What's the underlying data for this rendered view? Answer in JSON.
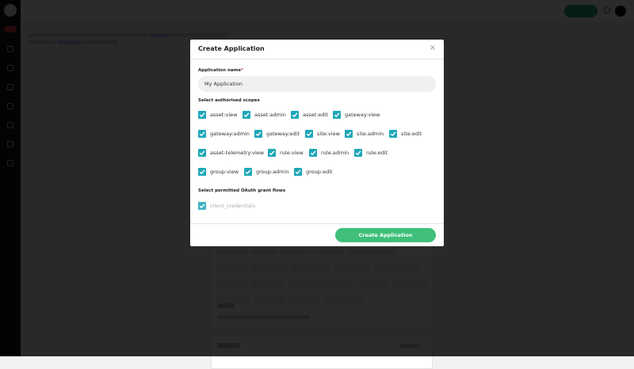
{
  "modal": {
    "title": "Create Application",
    "close_symbol": "×",
    "name_label": "Application name",
    "name_required_mark": "*",
    "name_value": "My Application",
    "scopes_label": "Select authorised scopes",
    "scopes": [
      "asset:view",
      "asset:admin",
      "asset:edit",
      "gateway:view",
      "gateway:admin",
      "gateway:edit",
      "site:view",
      "site:admin",
      "site:edit",
      "asset-telemetry:view",
      "rule:view",
      "rule:admin",
      "rule:edit",
      "group:view",
      "group:admin",
      "group:edit"
    ],
    "grants_label": "Select permitted OAuth grant flows",
    "grants": [
      "client_credentials"
    ],
    "create_label": "Create Application"
  },
  "colors": {
    "checkbox": "#1fa8b8",
    "primary_button": "#3fbf7a",
    "overlay": "rgba(0,0,0,0.83)"
  }
}
